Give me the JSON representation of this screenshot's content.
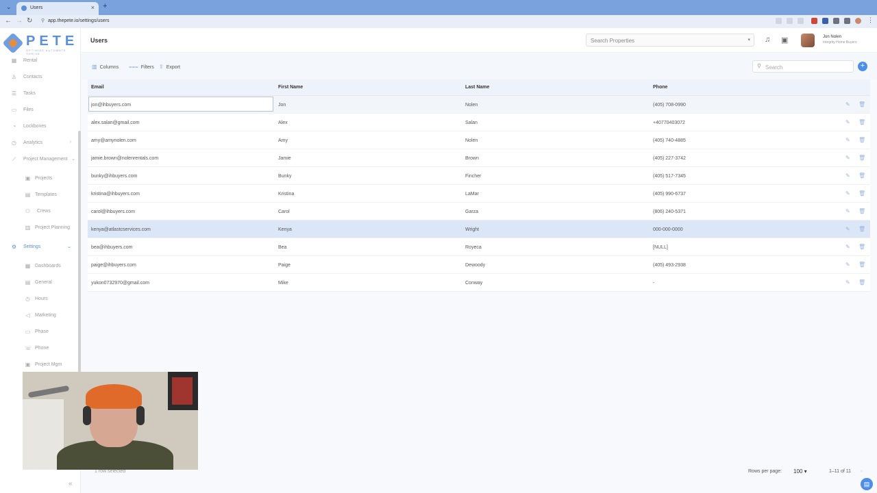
{
  "browser": {
    "tab_title": "Users",
    "url": "app.thepete.io/settings/users"
  },
  "brand": {
    "logo_text": "PETE",
    "tagline": "OPTIMIZE AUTOMATE THRIVE",
    "accent": "#5b8fd6",
    "orange": "#e88d3a"
  },
  "sidebar": {
    "items": [
      {
        "label": "Rental",
        "icon": "building-icon"
      },
      {
        "label": "Contacts",
        "icon": "person-icon"
      },
      {
        "label": "Tasks",
        "icon": "checklist-icon"
      },
      {
        "label": "Files",
        "icon": "folder-icon"
      },
      {
        "label": "Lockboxes",
        "icon": "lock-icon"
      },
      {
        "label": "Analytics",
        "icon": "chart-icon"
      },
      {
        "label": "Project Management",
        "icon": "trend-icon"
      }
    ],
    "pm_sub": [
      "Projects",
      "Templates",
      "Crews",
      "Project Planning"
    ],
    "settings_label": "Settings",
    "settings_sub": [
      "Dashboards",
      "General",
      "Hours",
      "Marketing",
      "Phase",
      "Phone",
      "Project Mgm"
    ]
  },
  "header": {
    "title": "Users",
    "search_placeholder": "Search Properties",
    "user_name": "Jon Nolen",
    "user_company": "Integrity Home Buyers"
  },
  "toolbar": {
    "columns": "Columns",
    "filters": "Filters",
    "export": "Export",
    "search_placeholder": "Search"
  },
  "table": {
    "columns": [
      "Email",
      "First Name",
      "Last Name",
      "Phone"
    ],
    "rows": [
      {
        "email": "jon@ihbuyers.com",
        "first": "Jon",
        "last": "Nolen",
        "phone": "(405) 708-0990"
      },
      {
        "email": "alex.salan@gmail.com",
        "first": "Alex",
        "last": "Salan",
        "phone": "+40770403072"
      },
      {
        "email": "amy@amynolen.com",
        "first": "Amy",
        "last": "Nolen",
        "phone": "(405) 740-4885"
      },
      {
        "email": "jamie.brown@nolenrentals.com",
        "first": "Jamie",
        "last": "Brown",
        "phone": "(405) 227-3742"
      },
      {
        "email": "bunky@ihbuyers.com",
        "first": "Bunky",
        "last": "Fincher",
        "phone": "(405) 517-7345"
      },
      {
        "email": "kristina@ihbuyers.com",
        "first": "Kristina",
        "last": "LaMar",
        "phone": "(405) 990-6737"
      },
      {
        "email": "carol@ihbuyers.com",
        "first": "Carol",
        "last": "Garza",
        "phone": "(806) 240-5371"
      },
      {
        "email": "kenya@atlastcservices.com",
        "first": "Kenya",
        "last": "Wright",
        "phone": "000-000-0000"
      },
      {
        "email": "bea@ihbuyers.com",
        "first": "Bea",
        "last": "Royeca",
        "phone": "[NULL]"
      },
      {
        "email": "paige@ihbuyers.com",
        "first": "Paige",
        "last": "Dewoody",
        "phone": "(405) 493-2938"
      },
      {
        "email": "yukon0732970@gmail.com",
        "first": "Mike",
        "last": "Conway",
        "phone": "-"
      }
    ]
  },
  "footer": {
    "rows_per_page_label": "Rows per page:",
    "rows_per_page": "100",
    "range": "1–11 of 11",
    "selected": "1 row selected"
  }
}
